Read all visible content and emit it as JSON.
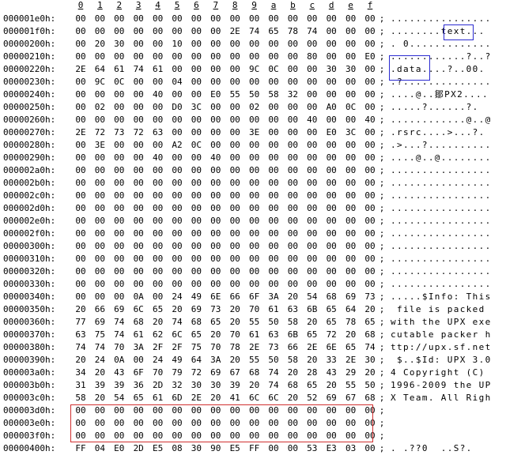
{
  "column_headers": [
    "0",
    "1",
    "2",
    "3",
    "4",
    "5",
    "6",
    "7",
    "8",
    "9",
    "a",
    "b",
    "c",
    "d",
    "e",
    "f"
  ],
  "separator": ";",
  "rows": [
    {
      "addr": "000001e0h:",
      "bytes": [
        "00",
        "00",
        "00",
        "00",
        "00",
        "00",
        "00",
        "00",
        "00",
        "00",
        "00",
        "00",
        "00",
        "00",
        "00",
        "00"
      ],
      "ascii": "................"
    },
    {
      "addr": "000001f0h:",
      "bytes": [
        "00",
        "00",
        "00",
        "00",
        "00",
        "00",
        "00",
        "00",
        "2E",
        "74",
        "65",
        "78",
        "74",
        "00",
        "00",
        "00"
      ],
      "ascii": "........text..."
    },
    {
      "addr": "00000200h:",
      "bytes": [
        "00",
        "20",
        "30",
        "00",
        "00",
        "10",
        "00",
        "00",
        "00",
        "00",
        "00",
        "00",
        "00",
        "00",
        "00",
        "00"
      ],
      "ascii": ". 0............."
    },
    {
      "addr": "00000210h:",
      "bytes": [
        "00",
        "00",
        "00",
        "00",
        "00",
        "00",
        "00",
        "00",
        "00",
        "00",
        "00",
        "00",
        "80",
        "00",
        "00",
        "E0"
      ],
      "ascii": "............?..?"
    },
    {
      "addr": "00000220h:",
      "bytes": [
        "2E",
        "64",
        "61",
        "74",
        "61",
        "00",
        "00",
        "00",
        "00",
        "9C",
        "0C",
        "00",
        "00",
        "30",
        "30",
        "00"
      ],
      "ascii": ".data....?..00."
    },
    {
      "addr": "00000230h:",
      "bytes": [
        "00",
        "9C",
        "0C",
        "00",
        "00",
        "04",
        "00",
        "00",
        "00",
        "00",
        "00",
        "00",
        "00",
        "00",
        "00",
        "00"
      ],
      "ascii": ".?.............."
    },
    {
      "addr": "00000240h:",
      "bytes": [
        "00",
        "00",
        "00",
        "00",
        "40",
        "00",
        "00",
        "E0",
        "55",
        "50",
        "58",
        "32",
        "00",
        "00",
        "00",
        "00"
      ],
      "ascii": "....@..鄒PX2...."
    },
    {
      "addr": "00000250h:",
      "bytes": [
        "00",
        "02",
        "00",
        "00",
        "00",
        "D0",
        "3C",
        "00",
        "00",
        "02",
        "00",
        "00",
        "00",
        "A0",
        "0C",
        "00"
      ],
      "ascii": ".....?......?."
    },
    {
      "addr": "00000260h:",
      "bytes": [
        "00",
        "00",
        "00",
        "00",
        "00",
        "00",
        "00",
        "00",
        "00",
        "00",
        "00",
        "00",
        "40",
        "00",
        "00",
        "40"
      ],
      "ascii": "............@..@"
    },
    {
      "addr": "00000270h:",
      "bytes": [
        "2E",
        "72",
        "73",
        "72",
        "63",
        "00",
        "00",
        "00",
        "00",
        "3E",
        "00",
        "00",
        "00",
        "E0",
        "3C",
        "00"
      ],
      "ascii": ".rsrc....>...?."
    },
    {
      "addr": "00000280h:",
      "bytes": [
        "00",
        "3E",
        "00",
        "00",
        "00",
        "A2",
        "0C",
        "00",
        "00",
        "00",
        "00",
        "00",
        "00",
        "00",
        "00",
        "00"
      ],
      "ascii": ".>...?.........."
    },
    {
      "addr": "00000290h:",
      "bytes": [
        "00",
        "00",
        "00",
        "00",
        "40",
        "00",
        "00",
        "40",
        "00",
        "00",
        "00",
        "00",
        "00",
        "00",
        "00",
        "00"
      ],
      "ascii": "....@..@........"
    },
    {
      "addr": "000002a0h:",
      "bytes": [
        "00",
        "00",
        "00",
        "00",
        "00",
        "00",
        "00",
        "00",
        "00",
        "00",
        "00",
        "00",
        "00",
        "00",
        "00",
        "00"
      ],
      "ascii": "................"
    },
    {
      "addr": "000002b0h:",
      "bytes": [
        "00",
        "00",
        "00",
        "00",
        "00",
        "00",
        "00",
        "00",
        "00",
        "00",
        "00",
        "00",
        "00",
        "00",
        "00",
        "00"
      ],
      "ascii": "................"
    },
    {
      "addr": "000002c0h:",
      "bytes": [
        "00",
        "00",
        "00",
        "00",
        "00",
        "00",
        "00",
        "00",
        "00",
        "00",
        "00",
        "00",
        "00",
        "00",
        "00",
        "00"
      ],
      "ascii": "................"
    },
    {
      "addr": "000002d0h:",
      "bytes": [
        "00",
        "00",
        "00",
        "00",
        "00",
        "00",
        "00",
        "00",
        "00",
        "00",
        "00",
        "00",
        "00",
        "00",
        "00",
        "00"
      ],
      "ascii": "................"
    },
    {
      "addr": "000002e0h:",
      "bytes": [
        "00",
        "00",
        "00",
        "00",
        "00",
        "00",
        "00",
        "00",
        "00",
        "00",
        "00",
        "00",
        "00",
        "00",
        "00",
        "00"
      ],
      "ascii": "................"
    },
    {
      "addr": "000002f0h:",
      "bytes": [
        "00",
        "00",
        "00",
        "00",
        "00",
        "00",
        "00",
        "00",
        "00",
        "00",
        "00",
        "00",
        "00",
        "00",
        "00",
        "00"
      ],
      "ascii": "................"
    },
    {
      "addr": "00000300h:",
      "bytes": [
        "00",
        "00",
        "00",
        "00",
        "00",
        "00",
        "00",
        "00",
        "00",
        "00",
        "00",
        "00",
        "00",
        "00",
        "00",
        "00"
      ],
      "ascii": "................"
    },
    {
      "addr": "00000310h:",
      "bytes": [
        "00",
        "00",
        "00",
        "00",
        "00",
        "00",
        "00",
        "00",
        "00",
        "00",
        "00",
        "00",
        "00",
        "00",
        "00",
        "00"
      ],
      "ascii": "................"
    },
    {
      "addr": "00000320h:",
      "bytes": [
        "00",
        "00",
        "00",
        "00",
        "00",
        "00",
        "00",
        "00",
        "00",
        "00",
        "00",
        "00",
        "00",
        "00",
        "00",
        "00"
      ],
      "ascii": "................"
    },
    {
      "addr": "00000330h:",
      "bytes": [
        "00",
        "00",
        "00",
        "00",
        "00",
        "00",
        "00",
        "00",
        "00",
        "00",
        "00",
        "00",
        "00",
        "00",
        "00",
        "00"
      ],
      "ascii": "................"
    },
    {
      "addr": "00000340h:",
      "bytes": [
        "00",
        "00",
        "00",
        "0A",
        "00",
        "24",
        "49",
        "6E",
        "66",
        "6F",
        "3A",
        "20",
        "54",
        "68",
        "69",
        "73"
      ],
      "ascii": ".....$Info: This"
    },
    {
      "addr": "00000350h:",
      "bytes": [
        "20",
        "66",
        "69",
        "6C",
        "65",
        "20",
        "69",
        "73",
        "20",
        "70",
        "61",
        "63",
        "6B",
        "65",
        "64",
        "20"
      ],
      "ascii": " file is packed "
    },
    {
      "addr": "00000360h:",
      "bytes": [
        "77",
        "69",
        "74",
        "68",
        "20",
        "74",
        "68",
        "65",
        "20",
        "55",
        "50",
        "58",
        "20",
        "65",
        "78",
        "65"
      ],
      "ascii": "with the UPX exe"
    },
    {
      "addr": "00000370h:",
      "bytes": [
        "63",
        "75",
        "74",
        "61",
        "62",
        "6C",
        "65",
        "20",
        "70",
        "61",
        "63",
        "6B",
        "65",
        "72",
        "20",
        "68"
      ],
      "ascii": "cutable packer h"
    },
    {
      "addr": "00000380h:",
      "bytes": [
        "74",
        "74",
        "70",
        "3A",
        "2F",
        "2F",
        "75",
        "70",
        "78",
        "2E",
        "73",
        "66",
        "2E",
        "6E",
        "65",
        "74"
      ],
      "ascii": "ttp://upx.sf.net"
    },
    {
      "addr": "00000390h:",
      "bytes": [
        "20",
        "24",
        "0A",
        "00",
        "24",
        "49",
        "64",
        "3A",
        "20",
        "55",
        "50",
        "58",
        "20",
        "33",
        "2E",
        "30"
      ],
      "ascii": " $..$Id: UPX 3.0"
    },
    {
      "addr": "000003a0h:",
      "bytes": [
        "34",
        "20",
        "43",
        "6F",
        "70",
        "79",
        "72",
        "69",
        "67",
        "68",
        "74",
        "20",
        "28",
        "43",
        "29",
        "20"
      ],
      "ascii": "4 Copyright (C) "
    },
    {
      "addr": "000003b0h:",
      "bytes": [
        "31",
        "39",
        "39",
        "36",
        "2D",
        "32",
        "30",
        "30",
        "39",
        "20",
        "74",
        "68",
        "65",
        "20",
        "55",
        "50"
      ],
      "ascii": "1996-2009 the UP"
    },
    {
      "addr": "000003c0h:",
      "bytes": [
        "58",
        "20",
        "54",
        "65",
        "61",
        "6D",
        "2E",
        "20",
        "41",
        "6C",
        "6C",
        "20",
        "52",
        "69",
        "67",
        "68"
      ],
      "ascii": "X Team. All Righ"
    },
    {
      "addr": "000003d0h:",
      "bytes": [
        "00",
        "00",
        "00",
        "00",
        "00",
        "00",
        "00",
        "00",
        "00",
        "00",
        "00",
        "00",
        "00",
        "00",
        "00",
        "00"
      ],
      "ascii": ""
    },
    {
      "addr": "000003e0h:",
      "bytes": [
        "00",
        "00",
        "00",
        "00",
        "00",
        "00",
        "00",
        "00",
        "00",
        "00",
        "00",
        "00",
        "00",
        "00",
        "00",
        "00"
      ],
      "ascii": ""
    },
    {
      "addr": "000003f0h:",
      "bytes": [
        "00",
        "00",
        "00",
        "00",
        "00",
        "00",
        "00",
        "00",
        "00",
        "00",
        "00",
        "00",
        "00",
        "00",
        "00",
        "00"
      ],
      "ascii": ""
    },
    {
      "addr": "00000400h:",
      "bytes": [
        "FF",
        "04",
        "E0",
        "2D",
        "E5",
        "08",
        "30",
        "90",
        "E5",
        "FF",
        "00",
        "00",
        "53",
        "E3",
        "03",
        "00"
      ],
      "ascii": ". .??0  ..S?."
    }
  ],
  "highlight_color_blue": "#2a2ad0",
  "highlight_color_red": "#d03030"
}
